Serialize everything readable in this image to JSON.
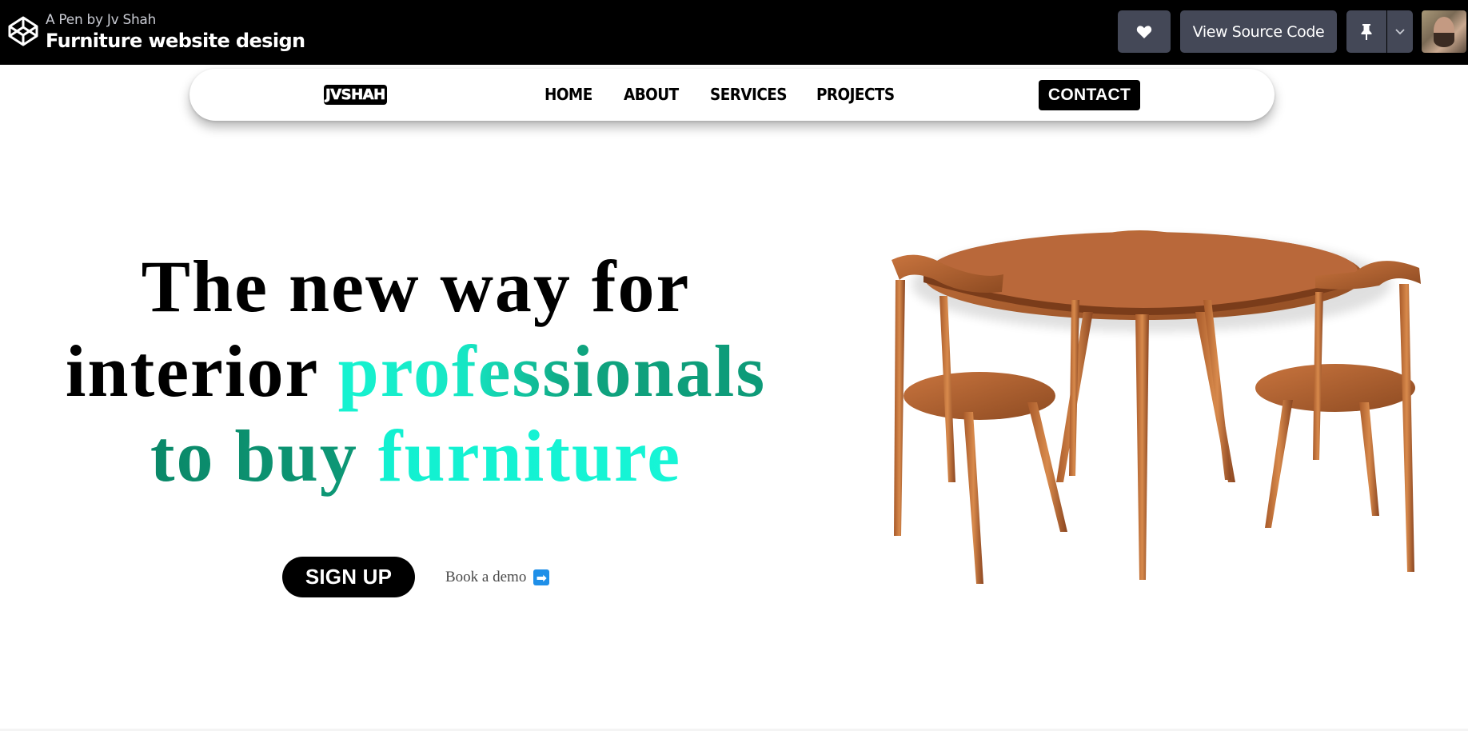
{
  "codepen": {
    "pen_by": "A Pen by Jv Shah",
    "pen_title": "Furniture website design",
    "view_source_label": "View Source Code",
    "icons": {
      "logo": "codepen-logo-icon",
      "heart": "heart-icon",
      "pin": "pin-icon",
      "caret": "chevron-down-icon",
      "avatar": "user-avatar"
    }
  },
  "nav": {
    "logo_text": "JVSHAH",
    "links": [
      "HOME",
      "ABOUT",
      "SERVICES",
      "PROJECTS"
    ],
    "contact_label": "CONTACT"
  },
  "hero": {
    "line1": "The new way for",
    "line2_plain": "interior ",
    "line2_accent": "professionals",
    "line3_accent_dark": "to buy ",
    "line3_accent": "furniture",
    "signup_label": "SIGN UP",
    "demo_label": "Book a demo",
    "demo_icon": "arrow-right-icon"
  },
  "colors": {
    "topbar_bg": "#000000",
    "button_bg": "#444857",
    "accent_teal_light": "#16f3d1",
    "accent_teal_dark": "#0e9a78",
    "contact_bg": "#000000",
    "demo_arrow_bg": "#1f8fe8"
  },
  "image": {
    "subject": "round wooden dining table with three chairs"
  }
}
